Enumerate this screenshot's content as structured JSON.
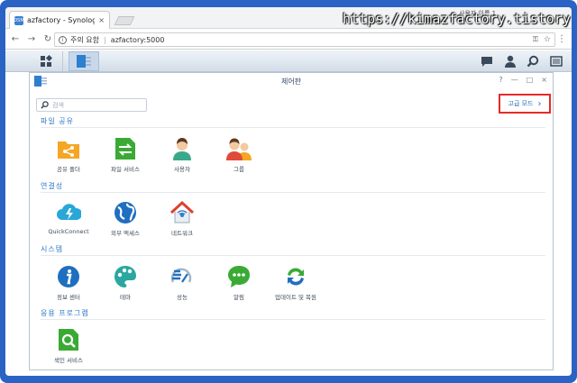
{
  "browser": {
    "tab_title": "azfactory - Synology Di",
    "favicon_text": "DSM",
    "close_glyph": "×",
    "user_label": "사용자 이름 1",
    "url_security": "주의 요함",
    "url_text": "azfactory:5000",
    "watermark": "https://kimazfactory.tistory.com"
  },
  "window": {
    "title": "제어판",
    "search_placeholder": "검색",
    "advanced_mode": "고급 모드",
    "controls": [
      "?",
      "—",
      "□",
      "×"
    ]
  },
  "sections": {
    "file_sharing": {
      "title": "파일 공유",
      "items": [
        "공유 폴더",
        "파일 서비스",
        "사용자",
        "그룹"
      ]
    },
    "connectivity": {
      "title": "연결성",
      "items": [
        "QuickConnect",
        "외부 액세스",
        "네트워크"
      ]
    },
    "system": {
      "title": "시스템",
      "items": [
        "정보 센터",
        "테마",
        "성능",
        "알림",
        "업데이트 및 복원"
      ]
    },
    "applications": {
      "title": "응용 프로그램",
      "items": [
        "색인 서비스"
      ]
    }
  },
  "colors": {
    "frame": "#2b63c4",
    "accent": "#2a78c6",
    "highlight_border": "#e52a2a"
  },
  "icons": {
    "shared_folder": "shared-folder-icon",
    "file_services": "file-services-icon",
    "user": "user-icon",
    "group": "group-icon",
    "quickconnect": "quickconnect-icon",
    "external_access": "external-access-icon",
    "network": "network-icon",
    "info_center": "info-center-icon",
    "theme": "theme-icon",
    "performance": "performance-icon",
    "notification": "notification-icon",
    "update_restore": "update-restore-icon",
    "indexing_service": "indexing-service-icon"
  }
}
